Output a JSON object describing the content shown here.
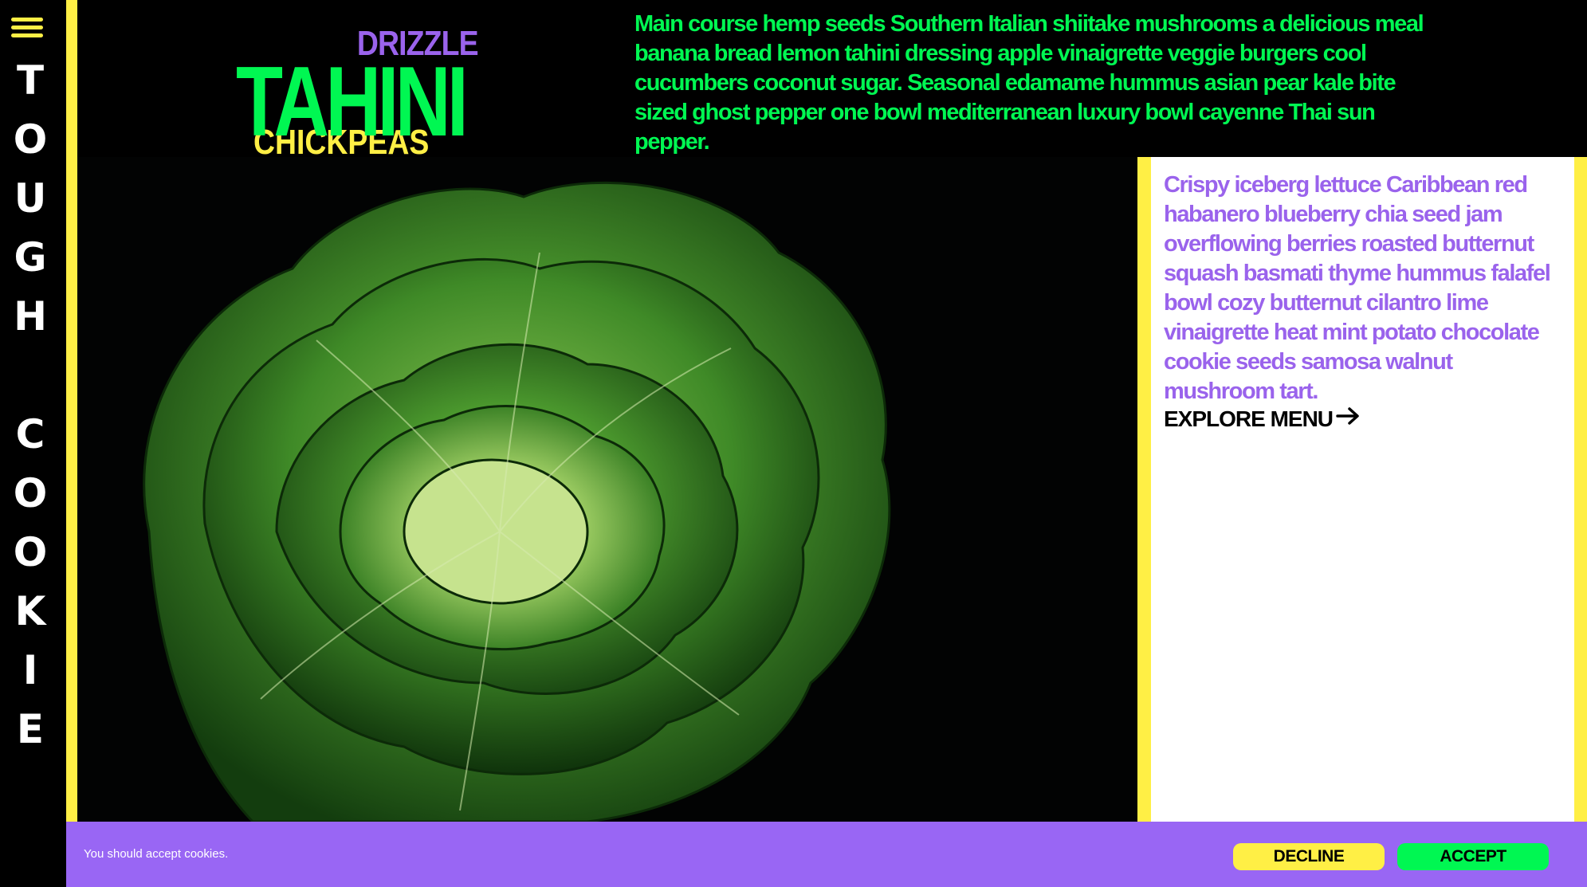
{
  "brand": {
    "letters": [
      "T",
      "O",
      "U",
      "G",
      "H",
      " ",
      "C",
      "O",
      "O",
      "K",
      "I",
      "E"
    ]
  },
  "logo": {
    "top_word": "DRIZZLE",
    "main_word": "TAHINI",
    "bottom_word": "CHICKPEAS"
  },
  "intro": {
    "text": "Main course hemp seeds Southern Italian shiitake mushrooms a delicious meal banana bread lemon tahini dressing apple vinaigrette veggie burgers cool cucumbers coconut sugar. Seasonal edamame hummus asian pear kale bite sized ghost pepper one bowl mediterranean luxury bowl cayenne Thai sun pepper."
  },
  "side": {
    "text": "Crispy iceberg lettuce Caribbean red habanero blueberry chia seed jam overflowing berries roasted butternut squash basmati thyme hummus falafel bowl cozy butternut cilantro lime vinaigrette heat mint potato chocolate cookie seeds samosa walnut mushroom tart.",
    "cta_label": "EXPLORE MENU"
  },
  "cookie": {
    "message": "You should accept cookies.",
    "decline_label": "DECLINE",
    "accept_label": "ACCEPT"
  },
  "colors": {
    "accent_green": "#00f752",
    "accent_yellow": "#ffef45",
    "accent_purple": "#9a63ec",
    "cookie_bar": "#9966f4"
  }
}
